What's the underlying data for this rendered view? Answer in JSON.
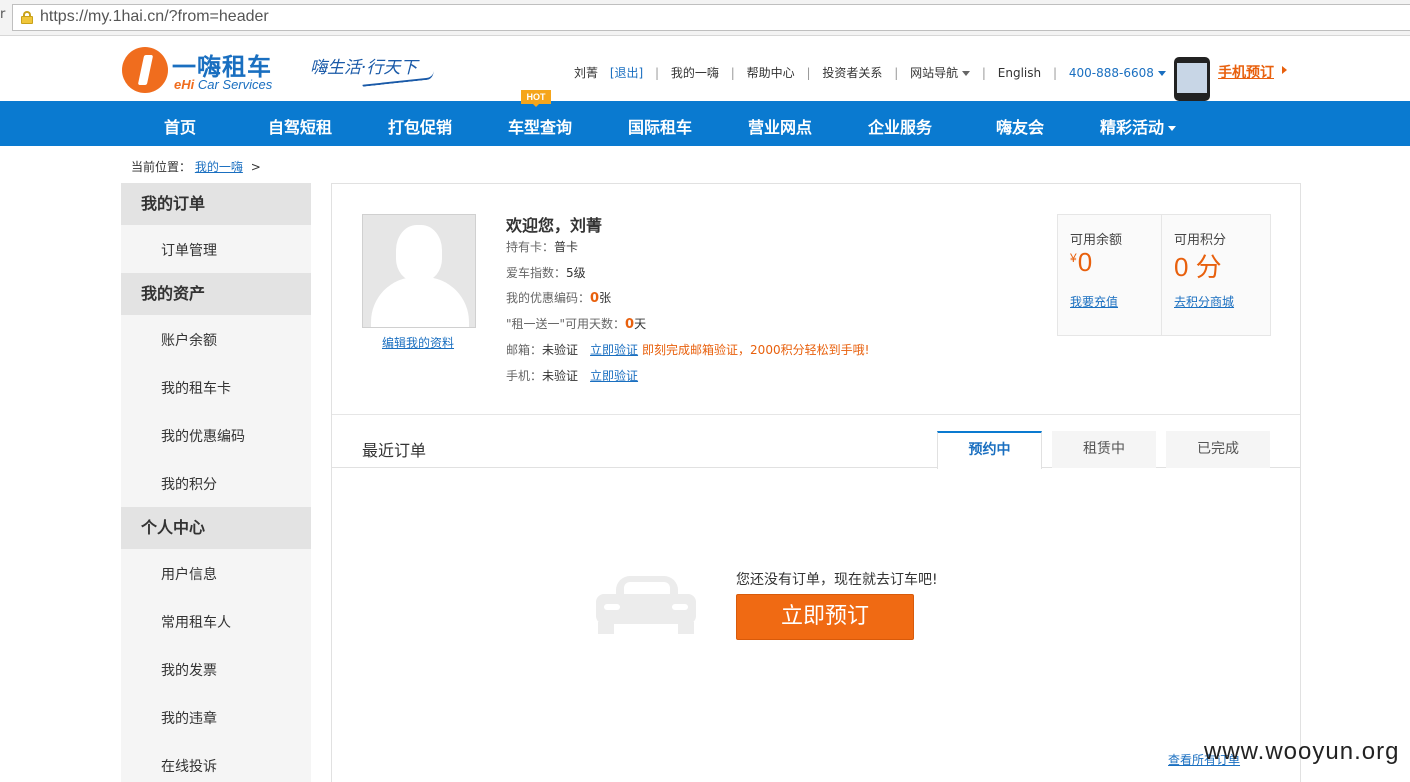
{
  "browser": {
    "left_mark": "r",
    "url": "https://my.1hai.cn/?from=header"
  },
  "header": {
    "logo_cn": "一嗨租车",
    "logo_en_brand": "eHi",
    "logo_en_rest": " Car Services",
    "slogan": "嗨生活·行天下",
    "user_name": "刘菁",
    "logout": "[退出]",
    "links": [
      "我的一嗨",
      "帮助中心",
      "投资者关系",
      "网站导航",
      "English"
    ],
    "phone": "400-888-6608",
    "mobile_booking": "手机预订"
  },
  "nav": {
    "items": [
      "首页",
      "自驾短租",
      "打包促销",
      "车型查询",
      "国际租车",
      "营业网点",
      "企业服务",
      "嗨友会",
      "精彩活动"
    ],
    "hot_badge": "HOT"
  },
  "breadcrumb": {
    "label": "当前位置：",
    "current": "我的一嗨",
    "arrow": ">"
  },
  "sidebar": {
    "groups": [
      {
        "title": "我的订单",
        "items": [
          "订单管理"
        ]
      },
      {
        "title": "我的资产",
        "items": [
          "账户余额",
          "我的租车卡",
          "我的优惠编码",
          "我的积分"
        ]
      },
      {
        "title": "个人中心",
        "items": [
          "用户信息",
          "常用租车人",
          "我的发票",
          "我的违章",
          "在线投诉"
        ]
      }
    ]
  },
  "profile": {
    "edit_link": "编辑我的资料",
    "welcome": "欢迎您，刘菁",
    "card_label": "持有卡：",
    "card_value": "普卡",
    "car_index_label": "爱车指数：",
    "car_index_value": "5级",
    "coupon_label": "我的优惠编码：",
    "coupon_value": "0",
    "coupon_unit": "张",
    "free_days_label": "\"租一送一\"可用天数：",
    "free_days_value": "0",
    "free_days_unit": "天",
    "email_label": "邮箱：",
    "email_status": "未验证",
    "email_verify": "立即验证",
    "email_promo": "即刻完成邮箱验证，2000积分轻松到手哦!",
    "mobile_label": "手机：",
    "mobile_status": "未验证",
    "mobile_verify": "立即验证"
  },
  "balance": {
    "balance_label": "可用余额",
    "currency": "¥",
    "balance_value": "0",
    "recharge_link": "我要充值",
    "points_label": "可用积分",
    "points_value": "0 分",
    "mall_link": "去积分商城"
  },
  "orders": {
    "title": "最近订单",
    "tabs": [
      "预约中",
      "租赁中",
      "已完成"
    ],
    "active_tab": 0,
    "empty_text": "您还没有订单，现在就去订车吧!",
    "book_button": "立即预订",
    "view_all": "查看所有订单"
  },
  "watermark": "www.wooyun.org",
  "colors": {
    "brand_blue": "#0a7ad0",
    "brand_orange": "#f06a13",
    "link_blue": "#1a6fc0"
  }
}
